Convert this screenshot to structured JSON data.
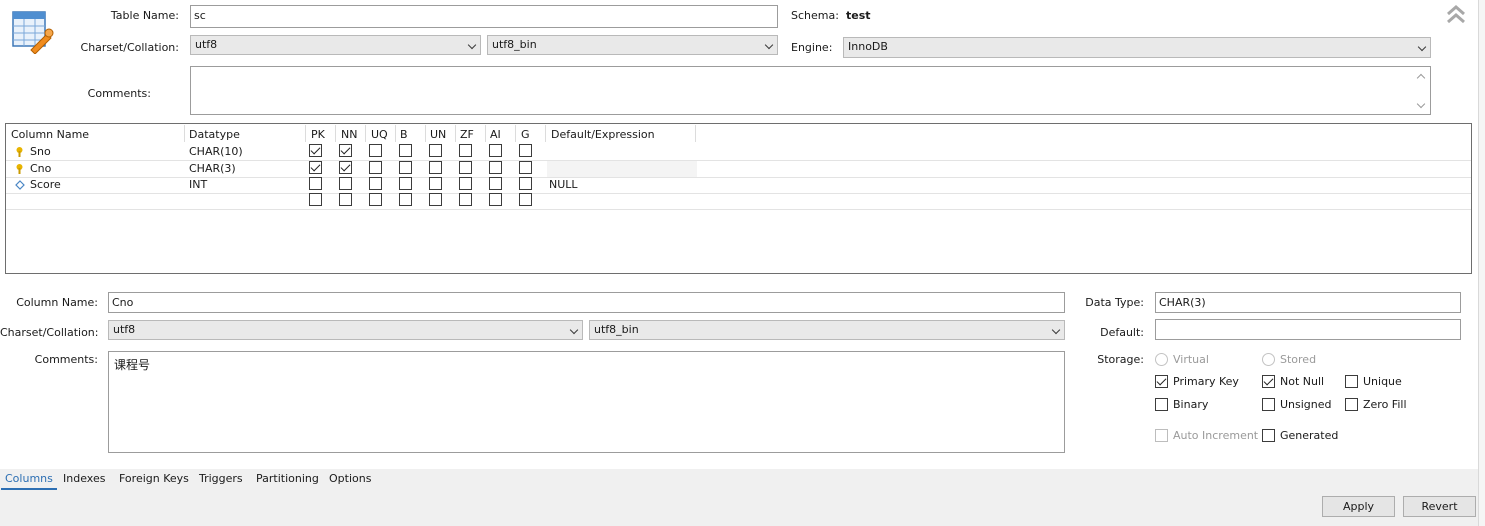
{
  "table": {
    "name_label": "Table Name:",
    "name_value": "sc",
    "schema_label": "Schema:",
    "schema_value": "test",
    "charset_label": "Charset/Collation:",
    "charset_value": "utf8",
    "collation_value": "utf8_bin",
    "engine_label": "Engine:",
    "engine_value": "InnoDB",
    "comments_label": "Comments:",
    "comments_value": ""
  },
  "grid": {
    "headers": [
      "Column Name",
      "Datatype",
      "PK",
      "NN",
      "UQ",
      "B",
      "UN",
      "ZF",
      "AI",
      "G",
      "Default/Expression"
    ],
    "rows": [
      {
        "icon": "key-icon",
        "name": "Sno",
        "type": "CHAR(10)",
        "flags": [
          true,
          true,
          false,
          false,
          false,
          false,
          false,
          false
        ],
        "default": ""
      },
      {
        "icon": "key-icon",
        "name": "Cno",
        "type": "CHAR(3)",
        "flags": [
          true,
          true,
          false,
          false,
          false,
          false,
          false,
          false
        ],
        "default": ""
      },
      {
        "icon": "diamond-icon",
        "name": "Score",
        "type": "INT",
        "flags": [
          false,
          false,
          false,
          false,
          false,
          false,
          false,
          false
        ],
        "default": "NULL"
      },
      {
        "icon": "",
        "name": "",
        "type": "",
        "flags": [
          false,
          false,
          false,
          false,
          false,
          false,
          false,
          false
        ],
        "default": ""
      }
    ]
  },
  "column": {
    "name_label": "Column Name:",
    "name_value": "Cno",
    "charset_label": "Charset/Collation:",
    "charset_value": "utf8",
    "collation_value": "utf8_bin",
    "comments_label": "Comments:",
    "comments_value": "课程号",
    "datatype_label": "Data Type:",
    "datatype_value": "CHAR(3)",
    "default_label": "Default:",
    "default_value": "",
    "storage_label": "Storage:",
    "virtual_label": "Virtual",
    "stored_label": "Stored",
    "primary_key_label": "Primary Key",
    "not_null_label": "Not Null",
    "unique_label": "Unique",
    "binary_label": "Binary",
    "unsigned_label": "Unsigned",
    "zero_fill_label": "Zero Fill",
    "auto_increment_label": "Auto Increment",
    "generated_label": "Generated",
    "primary_key_checked": true,
    "not_null_checked": true
  },
  "tabs": [
    "Columns",
    "Indexes",
    "Foreign Keys",
    "Triggers",
    "Partitioning",
    "Options"
  ],
  "buttons": {
    "apply": "Apply",
    "revert": "Revert"
  },
  "colors": {
    "accent": "#2d6fb3",
    "key_icon": "#e8b400",
    "diamond_icon": "#4a86c5"
  }
}
